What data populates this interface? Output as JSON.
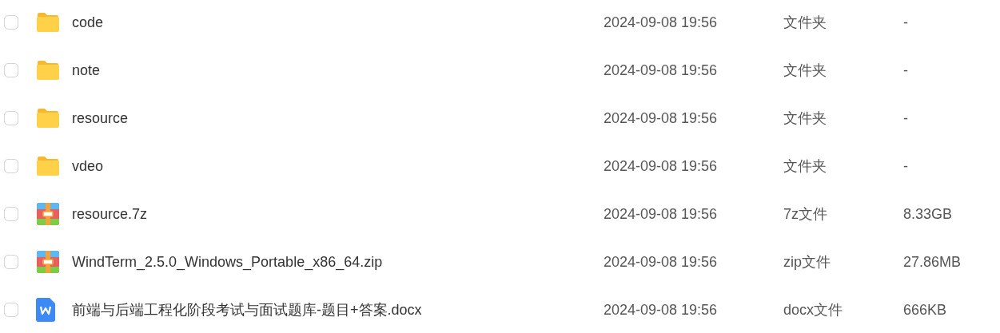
{
  "files": [
    {
      "kind": "folder",
      "name": "code",
      "modified": "2024-09-08 19:56",
      "type": "文件夹",
      "size": "-",
      "checked": false
    },
    {
      "kind": "folder",
      "name": "note",
      "modified": "2024-09-08 19:56",
      "type": "文件夹",
      "size": "-",
      "checked": false
    },
    {
      "kind": "folder",
      "name": "resource",
      "modified": "2024-09-08 19:56",
      "type": "文件夹",
      "size": "-",
      "checked": false
    },
    {
      "kind": "folder",
      "name": "vdeo",
      "modified": "2024-09-08 19:56",
      "type": "文件夹",
      "size": "-",
      "checked": false
    },
    {
      "kind": "archive",
      "name": "resource.7z",
      "modified": "2024-09-08 19:56",
      "type": "7z文件",
      "size": "8.33GB",
      "checked": false
    },
    {
      "kind": "archive",
      "name": "WindTerm_2.5.0_Windows_Portable_x86_64.zip",
      "modified": "2024-09-08 19:56",
      "type": "zip文件",
      "size": "27.86MB",
      "checked": false
    },
    {
      "kind": "word",
      "name": "前端与后端工程化阶段考试与面试题库-题目+答案.docx",
      "modified": "2024-09-08 19:56",
      "type": "docx文件",
      "size": "666KB",
      "checked": false
    }
  ]
}
